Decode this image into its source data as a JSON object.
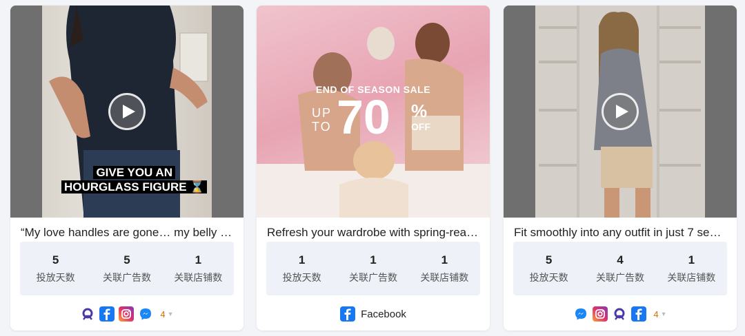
{
  "cards": [
    {
      "overlay_lines": [
        "GIVE YOU AN",
        "HOURGLASS FIGURE ⌛"
      ],
      "caption": "“My love handles are gone… my belly p…",
      "stats": [
        {
          "value": "5",
          "label": "投放天数"
        },
        {
          "value": "5",
          "label": "关联广告数"
        },
        {
          "value": "1",
          "label": "关联店铺数"
        }
      ],
      "platforms": [
        "threads-icon",
        "facebook-icon",
        "instagram-icon",
        "messenger-icon"
      ],
      "more_count": "4"
    },
    {
      "sale": {
        "title": "END OF SEASON SALE",
        "up": "UP",
        "to": "TO",
        "number": "70",
        "pct": "%",
        "off": "OFF"
      },
      "caption": "Refresh your wardrobe with spring-read…",
      "stats": [
        {
          "value": "1",
          "label": "投放天数"
        },
        {
          "value": "1",
          "label": "关联广告数"
        },
        {
          "value": "1",
          "label": "关联店铺数"
        }
      ],
      "platform_label": "Facebook"
    },
    {
      "caption": "Fit smoothly into any outfit in just 7 seco…",
      "stats": [
        {
          "value": "5",
          "label": "投放天数"
        },
        {
          "value": "4",
          "label": "关联广告数"
        },
        {
          "value": "1",
          "label": "关联店铺数"
        }
      ],
      "platforms": [
        "messenger-icon",
        "instagram-icon",
        "threads-icon",
        "facebook-icon"
      ],
      "more_count": "4"
    }
  ],
  "colors": {
    "facebook": "#1877f2",
    "instagram": "#c13584",
    "threads": "#4a3aa8",
    "more": "#e06b00",
    "stats_bg": "#eef1f8"
  }
}
